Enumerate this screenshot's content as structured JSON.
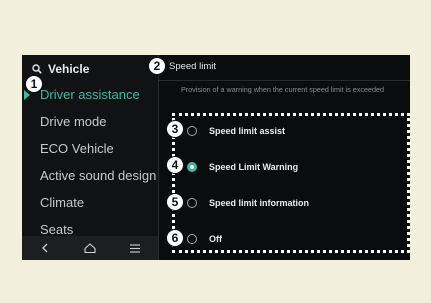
{
  "left_pane": {
    "title": "Vehicle",
    "search_icon": "search-icon",
    "menu_items": [
      {
        "label": "Driver assistance",
        "active": true
      },
      {
        "label": "Drive mode",
        "active": false
      },
      {
        "label": "ECO Vehicle",
        "active": false
      },
      {
        "label": "Active sound design",
        "active": false
      },
      {
        "label": "Climate",
        "active": false
      },
      {
        "label": "Seats",
        "active": false
      }
    ],
    "bottom_bar": [
      "back-icon",
      "home-icon",
      "menu-icon"
    ]
  },
  "right_pane": {
    "title": "Speed limit",
    "description": "Provision of a warning when the current speed limit is exceeded",
    "options": [
      {
        "label": "Speed limit assist",
        "selected": false
      },
      {
        "label": "Speed Limit Warning",
        "selected": true
      },
      {
        "label": "Speed limit information",
        "selected": false
      },
      {
        "label": "Off",
        "selected": false
      }
    ]
  },
  "callouts": [
    "1",
    "2",
    "3",
    "4",
    "5",
    "6"
  ],
  "colors": {
    "accent": "#3fb7a5",
    "background": "#0a0b0c",
    "page": "#f2efdc"
  }
}
